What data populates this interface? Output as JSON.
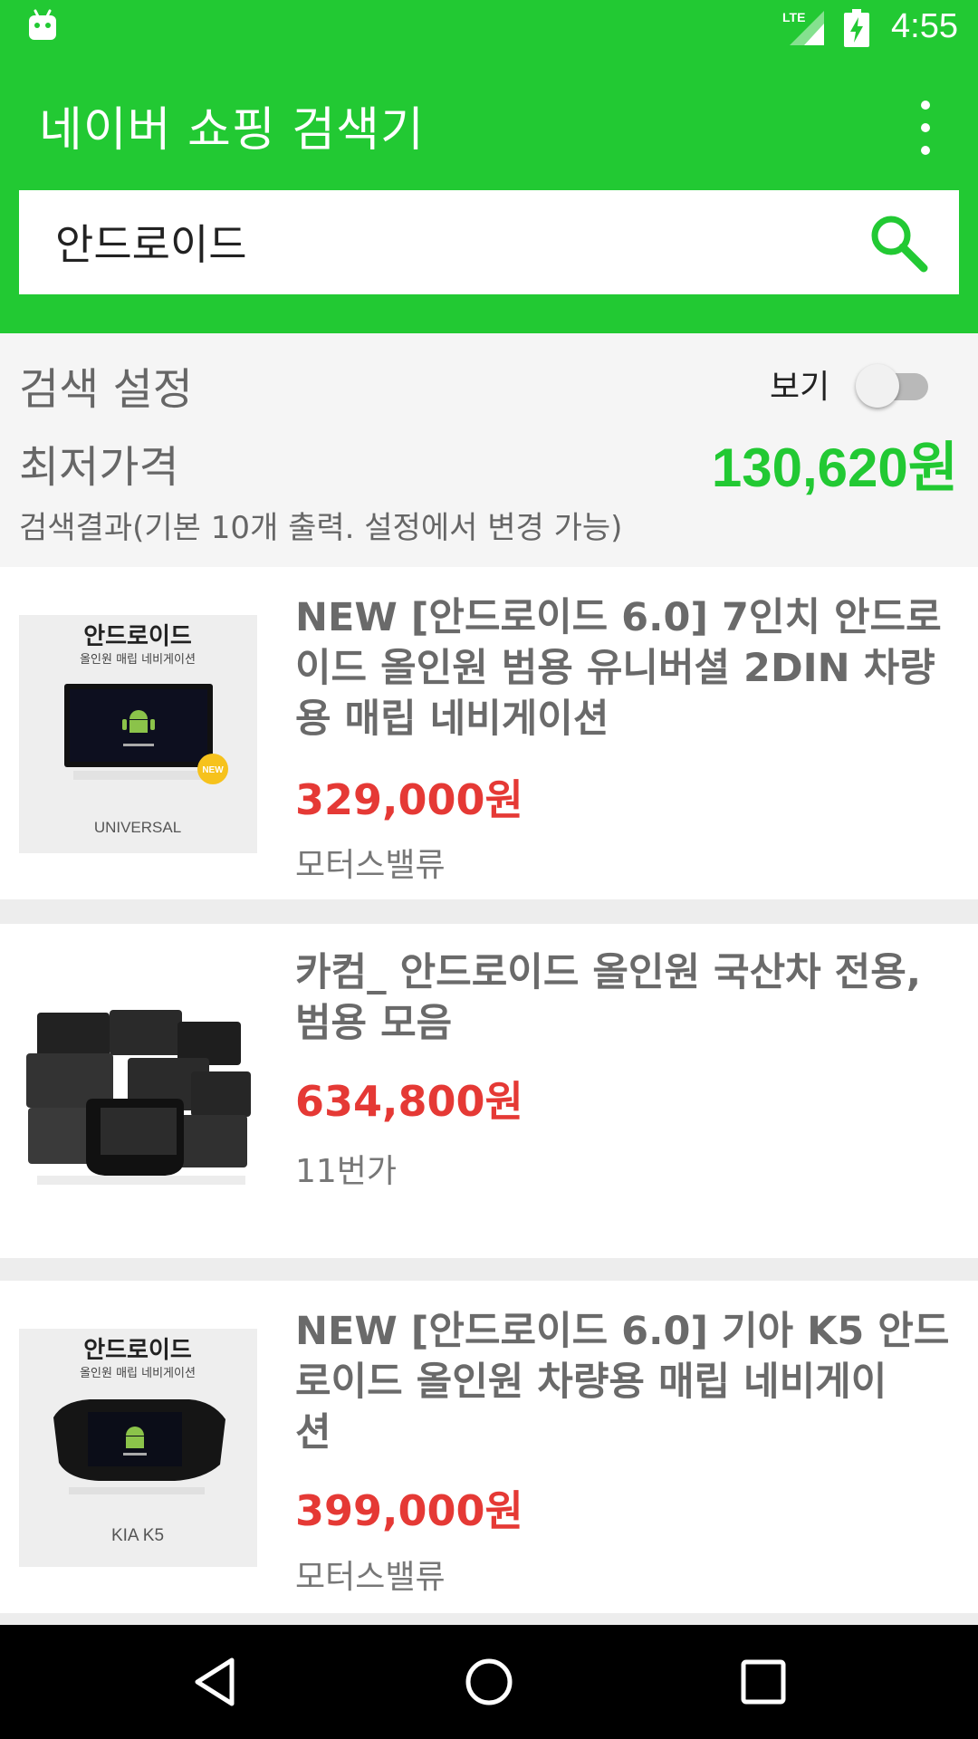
{
  "status_bar": {
    "time": "4:55",
    "icons": [
      "android-debug-icon",
      "lte-signal-icon",
      "battery-charging-icon"
    ]
  },
  "app_bar": {
    "title": "네이버 쇼핑 검색기",
    "menu_icon": "overflow-menu-icon"
  },
  "search": {
    "value": "안드로이드",
    "button_icon": "search-icon"
  },
  "settings": {
    "label": "검색 설정",
    "toggle_label": "보기",
    "toggle_on": false,
    "min_price_label": "최저가격",
    "min_price_value": "130,620원",
    "result_note": "검색결과(기본 10개 출력. 설정에서 변경 가능)"
  },
  "products": [
    {
      "title_lines": [
        "NEW [안드로이드 6.0] 7인치 안드로",
        "이드 올인원 범용 유니버셜 2DIN 차량",
        "용 매립 네비게이션"
      ],
      "price": "329,000원",
      "store": "모터스밸류",
      "image": {
        "heading": "안드로이드",
        "subheading": "올인원 매립 네비게이션",
        "badge": "NEW",
        "caption": "UNIVERSAL"
      }
    },
    {
      "title_lines": [
        "카컴_ 안드로이드 올인원 국산차 전용,",
        "범용 모음"
      ],
      "price": "634,800원",
      "store": "11번가",
      "image": {}
    },
    {
      "title_lines": [
        "NEW [안드로이드 6.0] 기아 K5 안드",
        "로이드 올인원 차량용 매립 네비게이",
        "션"
      ],
      "price": "399,000원",
      "store": "모터스밸류",
      "image": {
        "heading": "안드로이드",
        "subheading": "올인원 매립 네비게이션",
        "caption": "KIA K5"
      }
    }
  ],
  "nav_bar": {
    "icons": [
      "back-icon",
      "home-icon",
      "recents-icon"
    ]
  },
  "colors": {
    "primary_green": "#22c933",
    "price_red": "#e53935",
    "title_gray": "#6a6a6a"
  }
}
